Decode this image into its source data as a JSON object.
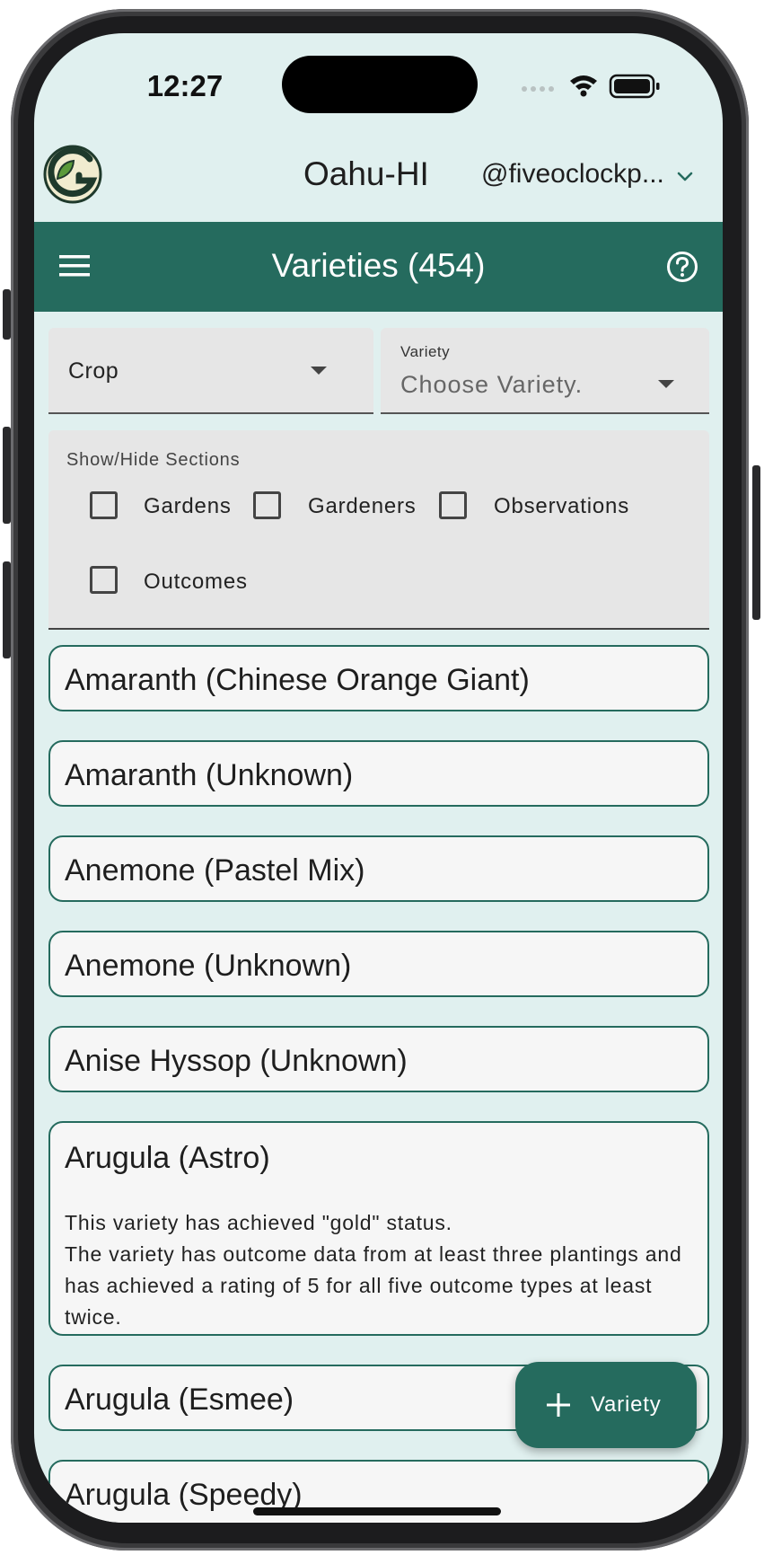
{
  "status_bar": {
    "time": "12:27"
  },
  "header": {
    "region": "Oahu-HI",
    "account": "@fiveoclockp...",
    "logo_icon": "gardenhub-logo-icon",
    "account_icon": "chevron-down-icon"
  },
  "appbar": {
    "title": "Varieties (454)",
    "menu_icon": "hamburger-menu-icon",
    "help_icon": "help-circle-icon",
    "color": "#256b5e"
  },
  "filters": {
    "crop": {
      "value": "Crop"
    },
    "variety": {
      "label": "Variety",
      "placeholder": "Choose Variety."
    }
  },
  "sections": {
    "label": "Show/Hide Sections",
    "options": [
      {
        "label": "Gardens",
        "checked": false
      },
      {
        "label": "Gardeners",
        "checked": false
      },
      {
        "label": "Observations",
        "checked": false
      },
      {
        "label": "Outcomes",
        "checked": false
      }
    ]
  },
  "varieties": [
    {
      "name": "Amaranth (Chinese Orange Giant)"
    },
    {
      "name": "Amaranth (Unknown)"
    },
    {
      "name": "Anemone (Pastel Mix)"
    },
    {
      "name": "Anemone (Unknown)"
    },
    {
      "name": "Anise Hyssop (Unknown)"
    },
    {
      "name": "Arugula (Astro)",
      "status_line": "This variety has achieved \"gold\" status.",
      "description": "The variety has outcome data from at least three plantings and has achieved a rating of 5 for all five outcome types at least twice."
    },
    {
      "name": "Arugula (Esmee)"
    },
    {
      "name": "Arugula (Speedy)"
    }
  ],
  "fab": {
    "label": "Variety",
    "icon": "plus-icon"
  }
}
